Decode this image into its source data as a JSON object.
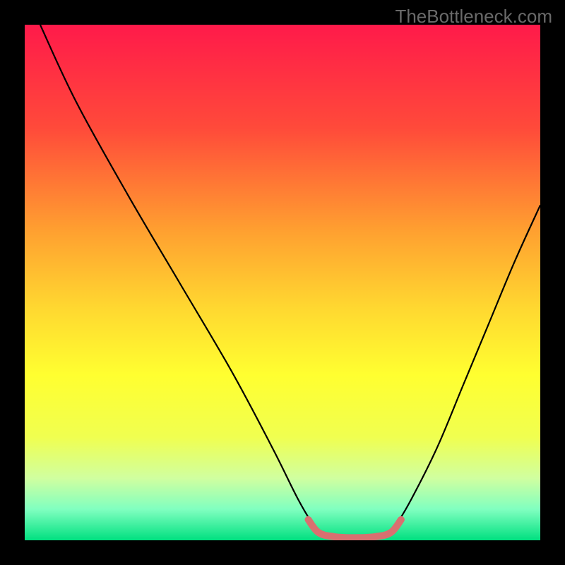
{
  "watermark": "TheBottleneck.com",
  "chart_data": {
    "type": "line",
    "title": "",
    "xlabel": "",
    "ylabel": "",
    "xlim": [
      0,
      100
    ],
    "ylim": [
      0,
      100
    ],
    "gradient_stops": [
      {
        "offset": 0,
        "color": "#ff1a4a"
      },
      {
        "offset": 20,
        "color": "#ff4a3a"
      },
      {
        "offset": 40,
        "color": "#ffa030"
      },
      {
        "offset": 55,
        "color": "#ffd830"
      },
      {
        "offset": 68,
        "color": "#ffff30"
      },
      {
        "offset": 80,
        "color": "#f0ff50"
      },
      {
        "offset": 88,
        "color": "#d0ffa0"
      },
      {
        "offset": 94,
        "color": "#80ffc0"
      },
      {
        "offset": 100,
        "color": "#00e080"
      }
    ],
    "series": [
      {
        "name": "bottleneck-curve",
        "points": [
          {
            "x": 3,
            "y": 100
          },
          {
            "x": 10,
            "y": 85
          },
          {
            "x": 20,
            "y": 67
          },
          {
            "x": 30,
            "y": 50
          },
          {
            "x": 40,
            "y": 33
          },
          {
            "x": 48,
            "y": 18
          },
          {
            "x": 53,
            "y": 8
          },
          {
            "x": 56,
            "y": 3
          },
          {
            "x": 58,
            "y": 1
          },
          {
            "x": 62,
            "y": 0.5
          },
          {
            "x": 66,
            "y": 0.5
          },
          {
            "x": 70,
            "y": 1
          },
          {
            "x": 72,
            "y": 3
          },
          {
            "x": 75,
            "y": 8
          },
          {
            "x": 80,
            "y": 18
          },
          {
            "x": 85,
            "y": 30
          },
          {
            "x": 90,
            "y": 42
          },
          {
            "x": 95,
            "y": 54
          },
          {
            "x": 100,
            "y": 65
          }
        ]
      },
      {
        "name": "bottom-highlight",
        "color": "#d87070",
        "width": 10,
        "points": [
          {
            "x": 55,
            "y": 4
          },
          {
            "x": 57,
            "y": 1.5
          },
          {
            "x": 60,
            "y": 0.7
          },
          {
            "x": 64,
            "y": 0.5
          },
          {
            "x": 68,
            "y": 0.7
          },
          {
            "x": 71,
            "y": 1.5
          },
          {
            "x": 73,
            "y": 4
          }
        ]
      }
    ]
  }
}
